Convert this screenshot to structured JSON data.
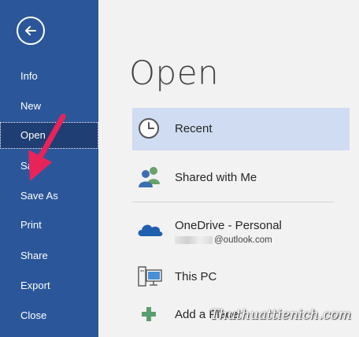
{
  "sidebar": {
    "items": [
      {
        "label": "Info"
      },
      {
        "label": "New"
      },
      {
        "label": "Open",
        "selected": true
      },
      {
        "label": "Save"
      },
      {
        "label": "Save As"
      },
      {
        "label": "Print"
      },
      {
        "label": "Share"
      },
      {
        "label": "Export"
      },
      {
        "label": "Close"
      }
    ]
  },
  "main": {
    "title": "Open",
    "places": [
      {
        "label": "Recent",
        "icon": "clock-icon",
        "selected": true
      },
      {
        "label": "Shared with Me",
        "icon": "people-icon"
      },
      {
        "label": "OneDrive - Personal",
        "sub": "@outlook.com",
        "icon": "cloud-icon"
      },
      {
        "label": "This PC",
        "icon": "computer-icon"
      },
      {
        "label": "Add a Place",
        "icon": "plus-icon"
      }
    ]
  },
  "watermark": "Thuthuattienich.com",
  "colors": {
    "sidebar": "#2b579a",
    "sidebar_selected": "#1f3e73",
    "recent_highlight": "#cfdcf2",
    "arrow": "#e8235a"
  }
}
